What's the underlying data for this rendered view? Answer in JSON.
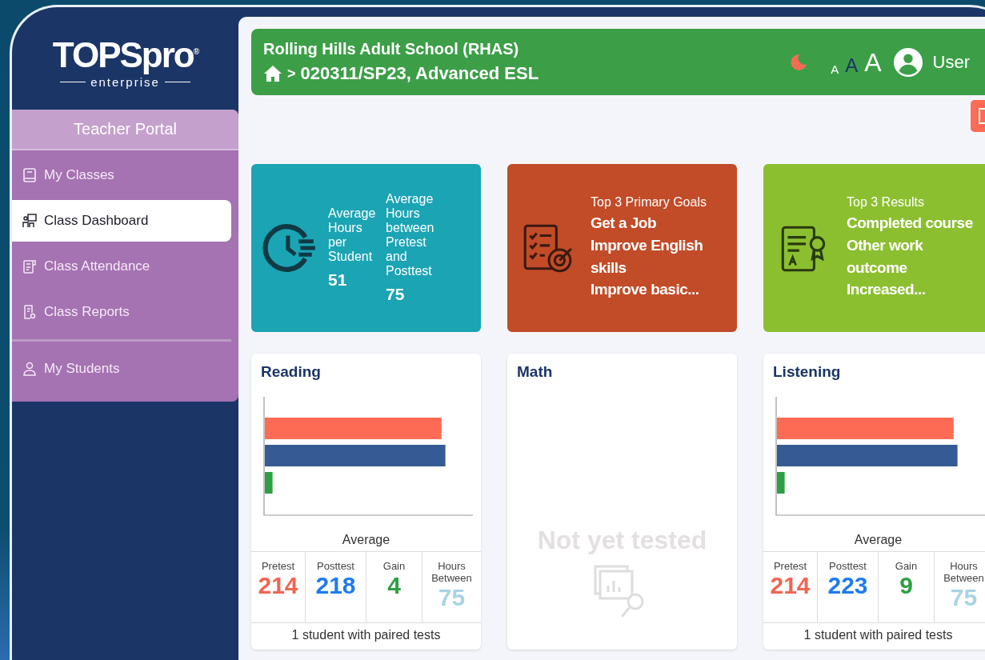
{
  "logo": {
    "name": "TOPSpro$^{®}$",
    "subtitle": "enterprise"
  },
  "portal": {
    "title": "Teacher Portal",
    "items": [
      {
        "label": "My Classes",
        "selected": false
      },
      {
        "label": "Class Dashboard",
        "selected": true
      },
      {
        "label": "Class Attendance",
        "selected": false
      },
      {
        "label": "Class Reports",
        "selected": false
      },
      {
        "label": "My Students",
        "selected": false
      }
    ]
  },
  "header": {
    "school": "Rolling Hills Adult School (RHAS)",
    "breadcrumb_separator": ">",
    "class": "020311/SP23, Advanced ESL",
    "font_sizes": [
      {
        "label": "A",
        "selected": false
      },
      {
        "label": "A",
        "selected": true
      },
      {
        "label": "A",
        "selected": false
      }
    ],
    "user": "User"
  },
  "summary_cards": [
    {
      "kind": "hours",
      "color": "#1ba4b4",
      "metrics": [
        {
          "label": "Average Hours per Student",
          "value": "51"
        },
        {
          "label": "Average Hours between Pretest and Posttest",
          "value": "75"
        }
      ]
    },
    {
      "kind": "list",
      "color": "#c24b28",
      "title": "Top 3 Primary Goals",
      "items": [
        "Get a Job",
        "Improve English skills",
        "Improve basic..."
      ]
    },
    {
      "kind": "list",
      "color": "#8cbf30",
      "title": "Top 3 Results",
      "items": [
        "Completed course",
        "Other work outcome",
        "Increased..."
      ]
    }
  ],
  "subjects": [
    {
      "kind": "scores",
      "title": "Reading",
      "chart_label": "Average",
      "stats": [
        {
          "kind": "pretest",
          "label": "Pretest",
          "value": "214"
        },
        {
          "kind": "posttest",
          "label": "Posttest",
          "value": "218"
        },
        {
          "kind": "gain",
          "label": "Gain",
          "value": "4"
        },
        {
          "kind": "hours",
          "label": "Hours Between",
          "value": "75"
        }
      ],
      "footer": "1 student with paired tests"
    },
    {
      "kind": "untested",
      "title": "Math",
      "message": "Not yet tested"
    },
    {
      "kind": "scores",
      "title": "Listening",
      "chart_label": "Average",
      "stats": [
        {
          "kind": "pretest",
          "label": "Pretest",
          "value": "214"
        },
        {
          "kind": "posttest",
          "label": "Posttest",
          "value": "223"
        },
        {
          "kind": "gain",
          "label": "Gain",
          "value": "9"
        },
        {
          "kind": "hours",
          "label": "Hours Between",
          "value": "75"
        }
      ],
      "footer": "1 student with paired tests"
    }
  ]
}
